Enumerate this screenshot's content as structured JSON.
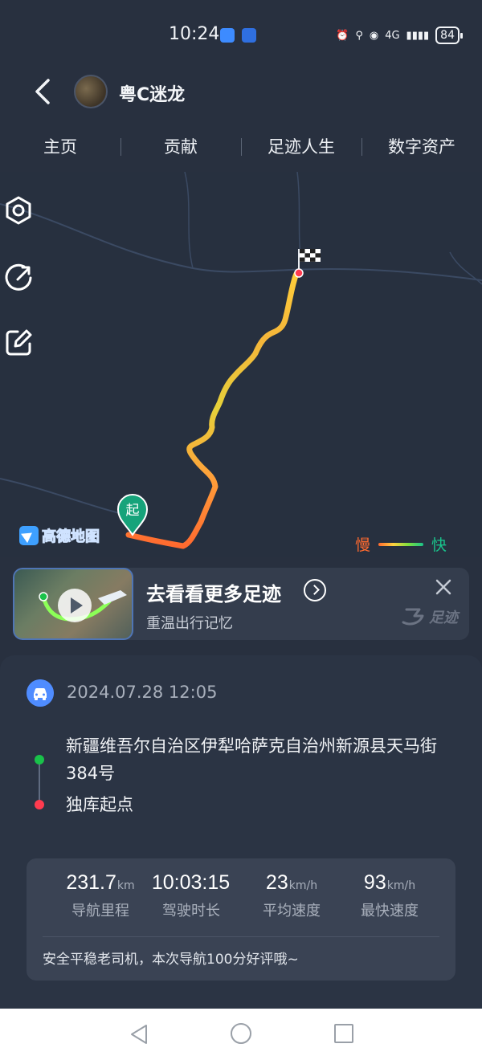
{
  "status_bar": {
    "time": "10:24",
    "signal": "4G",
    "battery": "84"
  },
  "header": {
    "back_icon": "chevron-left-icon",
    "user_name": "粤C迷龙"
  },
  "tabs": [
    {
      "label": "主页"
    },
    {
      "label": "贡献"
    },
    {
      "label": "足迹人生"
    },
    {
      "label": "数字资产"
    }
  ],
  "map": {
    "tools": [
      "settings-icon",
      "share-icon",
      "edit-icon"
    ],
    "start_marker": "起",
    "logo": "高德地图",
    "legend": {
      "slow": "慢",
      "fast": "快"
    },
    "colors": {
      "slow": "#ff6a2f",
      "mid": "#ffd23f",
      "fast": "#19c28b"
    }
  },
  "banner": {
    "title": "去看看更多足迹",
    "subtitle": "重温出行记忆",
    "brand": "足迹"
  },
  "trip": {
    "datetime": "2024.07.28 12:05",
    "start_address": "新疆维吾尔自治区伊犁哈萨克自治州新源县天马街384号",
    "end_address": "独库起点",
    "stats": [
      {
        "value": "231.7",
        "unit": "km",
        "label": "导航里程"
      },
      {
        "value": "10:03:15",
        "unit": "",
        "label": "驾驶时长"
      },
      {
        "value": "23",
        "unit": "km/h",
        "label": "平均速度"
      },
      {
        "value": "93",
        "unit": "km/h",
        "label": "最快速度"
      }
    ],
    "comment": "安全平稳老司机，本次导航100分好评哦~"
  }
}
